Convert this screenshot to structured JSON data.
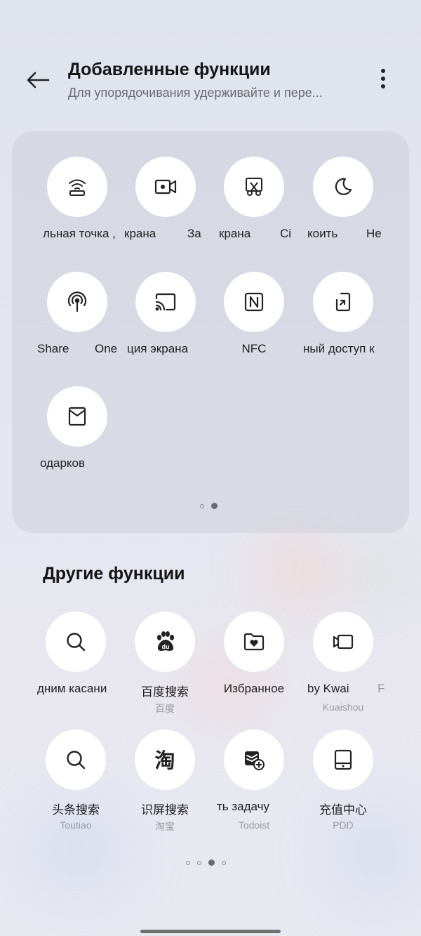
{
  "header": {
    "title": "Добавленные функции",
    "subtitle": "Для упорядочивания удерживайте и пере..."
  },
  "added": {
    "row1": [
      {
        "label": "льная точка ,",
        "icon": "wifi-hotspot-icon"
      },
      {
        "label": "крана",
        "label_extra": "За",
        "icon": "screen-record-icon"
      },
      {
        "label": "крана",
        "label_extra": "Сі",
        "icon": "screenshot-scissors-icon"
      },
      {
        "label": "коить",
        "label_extra": "Не",
        "icon": "moon-icon"
      }
    ],
    "row2": [
      {
        "label": "Share",
        "label_extra": "One",
        "icon": "nearby-share-icon"
      },
      {
        "label": "ция экрана",
        "icon": "cast-screen-icon"
      },
      {
        "label": "NFC",
        "icon": "nfc-icon"
      },
      {
        "label": "ный доступ к",
        "icon": "phone-transfer-icon"
      }
    ],
    "row3": [
      {
        "label": "одарков",
        "icon": "envelope-icon"
      }
    ],
    "page_dots": [
      false,
      true
    ]
  },
  "other": {
    "title": "Другие функции",
    "row1": [
      {
        "label": "дним касани",
        "sub": "",
        "icon": "search-icon"
      },
      {
        "label": "百度搜索",
        "sub": "百度",
        "icon": "baidu-paw-icon"
      },
      {
        "label": "Избранное",
        "sub": "",
        "icon": "folder-heart-icon"
      },
      {
        "label": "by Kwai",
        "sub": "Kuaishou",
        "label_extra": "F",
        "icon": "kwai-camera-icon"
      }
    ],
    "row2": [
      {
        "label": "头条搜索",
        "sub": "Toutiao",
        "icon": "search-icon"
      },
      {
        "label": "识屏搜索",
        "sub": "淘宝",
        "icon": "taobao-icon"
      },
      {
        "label": "ть задачу",
        "sub": "Todoist",
        "icon": "todoist-add-icon"
      },
      {
        "label": "充值中心",
        "sub": "PDD",
        "icon": "recharge-tablet-icon"
      }
    ],
    "page_dots": [
      false,
      false,
      true,
      false
    ]
  },
  "colors": {
    "circle_bg": "#ffffff",
    "panel_bg": "#cfd1db",
    "text_primary": "#151515",
    "text_secondary": "#6c6c72"
  }
}
